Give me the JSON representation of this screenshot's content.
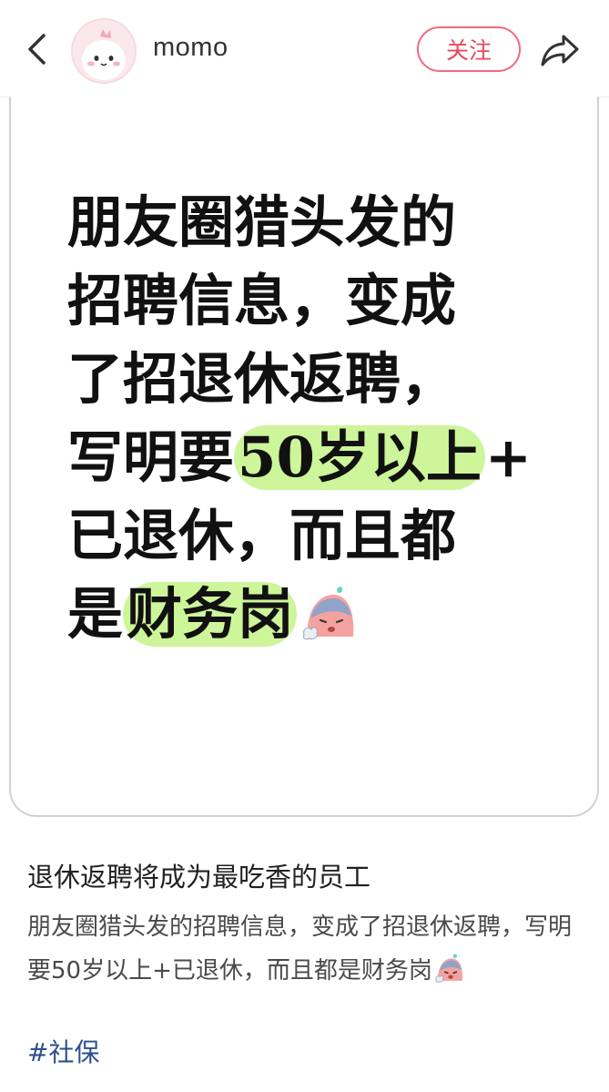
{
  "header": {
    "username": "momo",
    "follow_label": "关注",
    "back_icon": "chevron-left-icon",
    "share_icon": "share-arrow-icon"
  },
  "card": {
    "lines": [
      "朋友圈猎头发的",
      "招聘信息，变成",
      "了招退休返聘，"
    ],
    "line4_prefix": "写明要",
    "line4_highlight": "50岁以上",
    "line4_suffix": "+",
    "line5": "已退休，而且都",
    "line6_prefix": "是",
    "line6_highlight": "财务岗",
    "highlight_color": "#cdf59a",
    "emoji": "sad-sweating-emoji"
  },
  "post": {
    "title": "退休返聘将成为最吃香的员工",
    "body": "朋友圈猎头发的招聘信息，变成了招退休返聘，写明要50岁以上+已退休，而且都是财务岗",
    "hashtag": "#社保"
  },
  "colors": {
    "follow": "#e8475c",
    "hashtag": "#2d4f8d"
  }
}
